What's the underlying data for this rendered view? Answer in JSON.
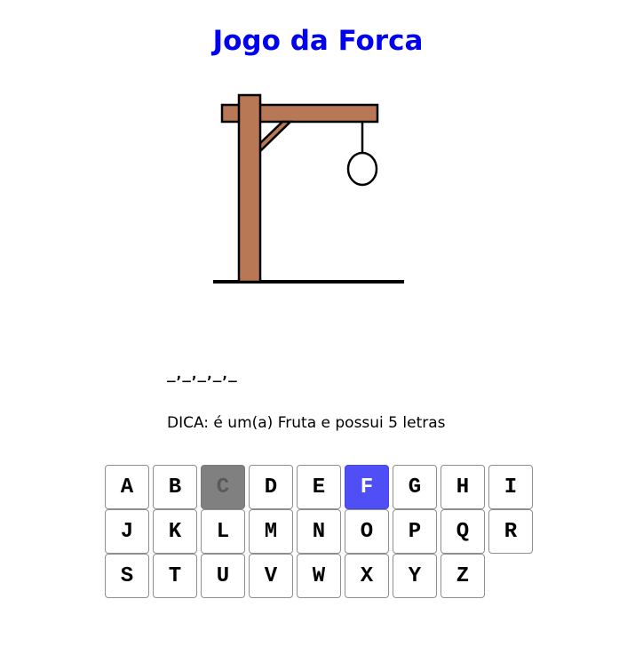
{
  "game": {
    "title": "Jogo da Forca",
    "word_display": "_,_,_,_,_",
    "hint": "DICA: é um(a) Fruta e possui 5 letras"
  },
  "colors": {
    "title": "#0000ee",
    "wood": "#b87855",
    "outline": "#000000",
    "key_disabled": "#808080",
    "key_active": "#4f4ff5"
  },
  "icons": {
    "gallows": "gallows-with-noose"
  },
  "keyboard": {
    "keys": [
      {
        "letter": "A",
        "state": "normal"
      },
      {
        "letter": "B",
        "state": "normal"
      },
      {
        "letter": "C",
        "state": "disabled"
      },
      {
        "letter": "D",
        "state": "normal"
      },
      {
        "letter": "E",
        "state": "normal"
      },
      {
        "letter": "F",
        "state": "active"
      },
      {
        "letter": "G",
        "state": "normal"
      },
      {
        "letter": "H",
        "state": "normal"
      },
      {
        "letter": "I",
        "state": "normal"
      },
      {
        "letter": "J",
        "state": "normal"
      },
      {
        "letter": "K",
        "state": "normal"
      },
      {
        "letter": "L",
        "state": "normal"
      },
      {
        "letter": "M",
        "state": "normal"
      },
      {
        "letter": "N",
        "state": "normal"
      },
      {
        "letter": "O",
        "state": "normal"
      },
      {
        "letter": "P",
        "state": "normal"
      },
      {
        "letter": "Q",
        "state": "normal"
      },
      {
        "letter": "R",
        "state": "normal"
      },
      {
        "letter": "S",
        "state": "normal"
      },
      {
        "letter": "T",
        "state": "normal"
      },
      {
        "letter": "U",
        "state": "normal"
      },
      {
        "letter": "V",
        "state": "normal"
      },
      {
        "letter": "W",
        "state": "normal"
      },
      {
        "letter": "X",
        "state": "normal"
      },
      {
        "letter": "Y",
        "state": "normal"
      },
      {
        "letter": "Z",
        "state": "normal"
      }
    ]
  }
}
